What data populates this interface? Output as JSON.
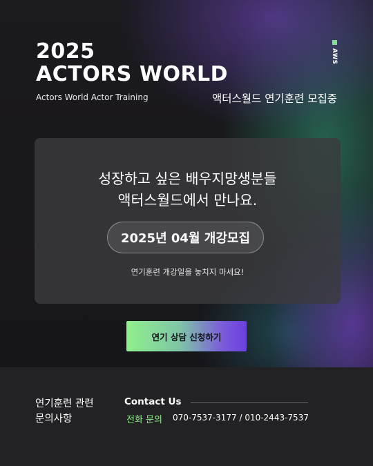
{
  "header": {
    "year": "2025",
    "title": "ACTORS WORLD",
    "subtitle_en": "Actors World Actor Training",
    "subtitle_ko": "액터스월드 연기훈련 모집중",
    "side_tag": "AWS",
    "side_tag_color": "#7de08f"
  },
  "card": {
    "headline_line1": "성장하고 싶은 배우지망생분들",
    "headline_line2": "액터스월드에서 만나요.",
    "pill_text": "2025년 04월 개강모집",
    "note": "연기훈련 개강일을 놓치지 마세요!"
  },
  "cta": {
    "label": "연기 상담 신청하기"
  },
  "footer": {
    "heading_line1": "연기훈련 관련",
    "heading_line2": "문의사항",
    "contact_title": "Contact Us",
    "phone_label": "전화 문의",
    "phone_numbers": "070-7537-3177 / 010-2443-7537",
    "accent_color": "#8ff08a"
  }
}
